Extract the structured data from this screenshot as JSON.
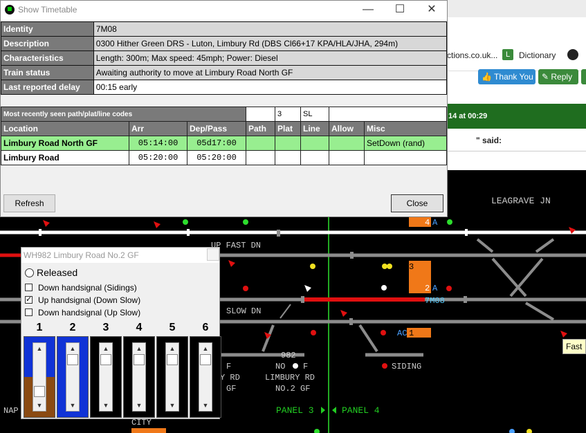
{
  "timetable_window": {
    "title": "Show Timetable",
    "controls": {
      "minimize": "—",
      "maximize": "☐",
      "close": "✕"
    },
    "info": [
      {
        "label": "Identity",
        "value": "7M08"
      },
      {
        "label": "Description",
        "value": "0300 Hither Green DRS - Luton, Limbury Rd (DBS Cl66+17 KPA/HLA/JHA, 294m)"
      },
      {
        "label": "Characteristics",
        "value": "Length: 300m; Max speed: 45mph; Power: Diesel"
      },
      {
        "label": "Train status",
        "value": "Awaiting authority to move at Limbury Road North GF"
      },
      {
        "label": "Last reported delay",
        "value": "00:15 early"
      }
    ],
    "codes_row": {
      "label": "Most recently seen path/plat/line codes",
      "path": "",
      "plat": "3",
      "line": "SL",
      "allow": ""
    },
    "columns": [
      "Location",
      "Arr",
      "Dep/Pass",
      "Path",
      "Plat",
      "Line",
      "Allow",
      "Misc"
    ],
    "rows": [
      {
        "location": "Limbury Road North GF",
        "arr": "05:14:00",
        "dep": "05d17:00",
        "path": "",
        "plat": "",
        "line": "",
        "allow": "",
        "misc": "SetDown (rand)"
      },
      {
        "location": "Limbury Road",
        "arr": "05:20:00",
        "dep": "05:20:00",
        "path": "",
        "plat": "",
        "line": "",
        "allow": "",
        "misc": ""
      }
    ],
    "refresh_label": "Refresh",
    "close_label": "Close"
  },
  "ground_frame_window": {
    "title": "WH982 Limbury Road No.2 GF",
    "released_label": "Released",
    "options": [
      {
        "label": "Down handsignal (Sidings)",
        "checked": false
      },
      {
        "label": "Up handsignal (Down Slow)",
        "checked": true
      },
      {
        "label": "Down handsignal (Up Slow)",
        "checked": false
      }
    ],
    "levers": [
      {
        "number": "1",
        "state": "reversed"
      },
      {
        "number": "2",
        "state": "blue"
      },
      {
        "number": "3",
        "state": "normal"
      },
      {
        "number": "4",
        "state": "normal"
      },
      {
        "number": "5",
        "state": "normal"
      },
      {
        "number": "6",
        "state": "normal"
      }
    ]
  },
  "browser_background": {
    "bookmark_site": "ctions.co.uk...",
    "bookmark_dictionary": "Dictionary",
    "thank_you_label": "👍 Thank You",
    "reply_label": "✎ Reply",
    "timestamp_fragment": "14 at 00:29",
    "said_label": "\" said:"
  },
  "panel": {
    "labels": {
      "leagrave": "LEAGRAVE JN",
      "up_fast_dn": "UP FAST DN",
      "slow_dn": "SLOW DN",
      "siding": "SIDING",
      "wh982": "982",
      "gf_no": "NO",
      "gf_f": "F",
      "limbury_rd_left": "Y RD",
      "gf_left": "GF",
      "gf_left_f": "F",
      "limbury_rd": "LIMBURY RD",
      "no2_gf": "NO.2 GF",
      "panel3": "PANEL 3",
      "panel4": "PANEL 4",
      "nap": "NAP",
      "city": "CITY",
      "train_id": "7M08",
      "berth_4a": "4",
      "berth_a_top": "A",
      "berth_2": "2",
      "berth_2a": "A",
      "berth_ac": "AC",
      "berth_1": "1",
      "berth_3": "3",
      "fast_tip": "Fast"
    },
    "colors": {
      "track": "#8c8c8c",
      "occupied": "#e01010",
      "berth": "#f07818",
      "panel_boundary": "#22aa22",
      "text": "#cccccc",
      "clear_track": "#ffffff"
    }
  }
}
